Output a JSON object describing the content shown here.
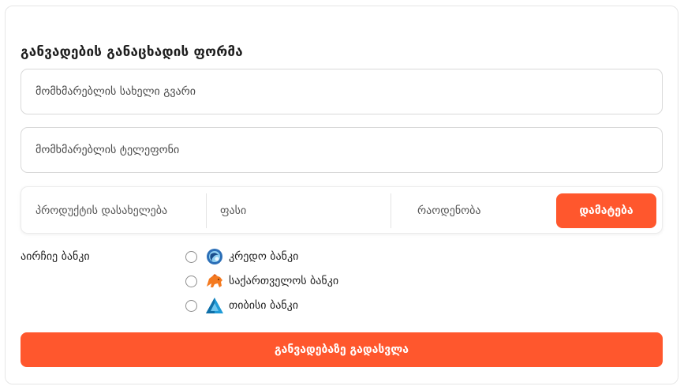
{
  "form": {
    "title": "განვადების განაცხადის ფორმა",
    "name_placeholder": "მომხმარებლის სახელი გვარი",
    "phone_placeholder": "მომხმარებლის ტელეფონი"
  },
  "product": {
    "name_placeholder": "პროდუქტის დასახელება",
    "price_placeholder": "ფასი",
    "quantity_placeholder": "რაოდენობა",
    "add_label": "დამატება"
  },
  "banks": {
    "label": "აირჩიე ბანკი",
    "options": [
      {
        "label": "კრედო ბანკი",
        "icon": "credo-bank-logo-icon"
      },
      {
        "label": "საქართველოს ბანკი",
        "icon": "bank-of-georgia-logo-icon"
      },
      {
        "label": "თიბისი ბანკი",
        "icon": "tbc-bank-logo-icon"
      }
    ]
  },
  "submit_label": "განვადებაზე გადასვლა",
  "colors": {
    "accent": "#ff572d",
    "border": "#d9d9d9"
  }
}
